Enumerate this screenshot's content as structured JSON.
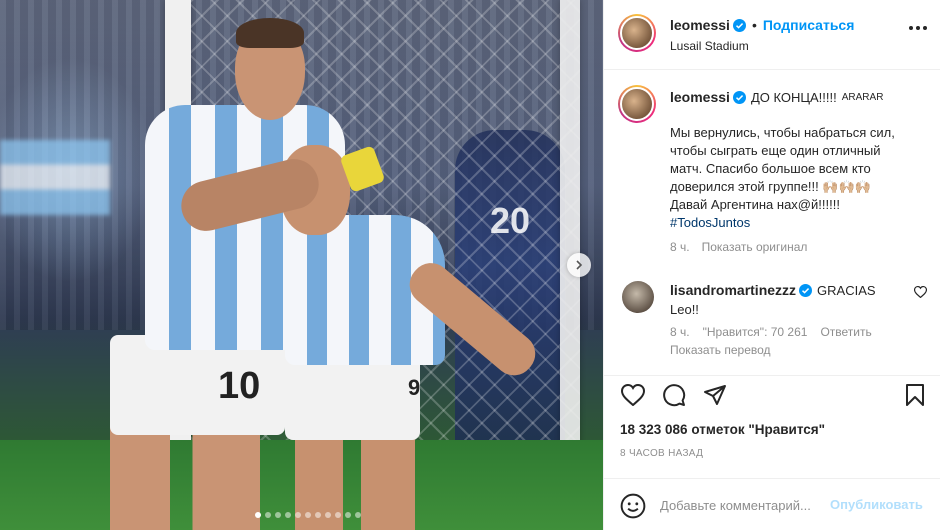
{
  "post": {
    "username": "leomessi",
    "follow_label": "Подписаться",
    "location": "Lusail Stadium",
    "separator": "•"
  },
  "photo": {
    "jersey_number_front": "10",
    "jersey_number_back": "9",
    "opponent_number": "20",
    "carousel_dots": 11,
    "carousel_active_index": 0
  },
  "caption": {
    "username": "leomessi",
    "title": "ДО КОНЦА!!!!!",
    "tag": "ARARAR",
    "lines": [
      "Мы вернулись, чтобы набраться сил,",
      "чтобы сыграть еще один отличный",
      "матч. Спасибо большое всем кто",
      "доверился этой группе!!! 🙌🏼🙌🏼🙌🏼",
      "Давай Аргентина нах@й!!!!!!"
    ],
    "hashtag": "#TodosJuntos",
    "time": "8 ч.",
    "show_original": "Показать оригинал"
  },
  "comment": {
    "username": "lisandromartinezzz",
    "text": "GRACIAS",
    "text_line2": "Leo!!",
    "time": "8 ч.",
    "likes": "\"Нравится\": 70 261",
    "reply": "Ответить",
    "translate": "Показать перевод"
  },
  "stats": {
    "likes": "18 323 086 отметок \"Нравится\"",
    "posted_ago": "8 ЧАСОВ НАЗАД"
  },
  "composer": {
    "placeholder": "Добавьте комментарий...",
    "publish_label": "Опубликовать"
  },
  "colors": {
    "accent": "#0095f6",
    "verified": "#0095f6",
    "publish_disabled": "#b2dffc",
    "muted": "#8e8e8e",
    "text": "#262626"
  },
  "icons": {
    "verified": "verified-badge-icon",
    "more": "more-options-icon",
    "like": "heart-icon",
    "comment": "comment-bubble-icon",
    "share": "paper-plane-icon",
    "save": "bookmark-icon",
    "emoji": "smiley-icon",
    "next": "chevron-right-icon"
  }
}
